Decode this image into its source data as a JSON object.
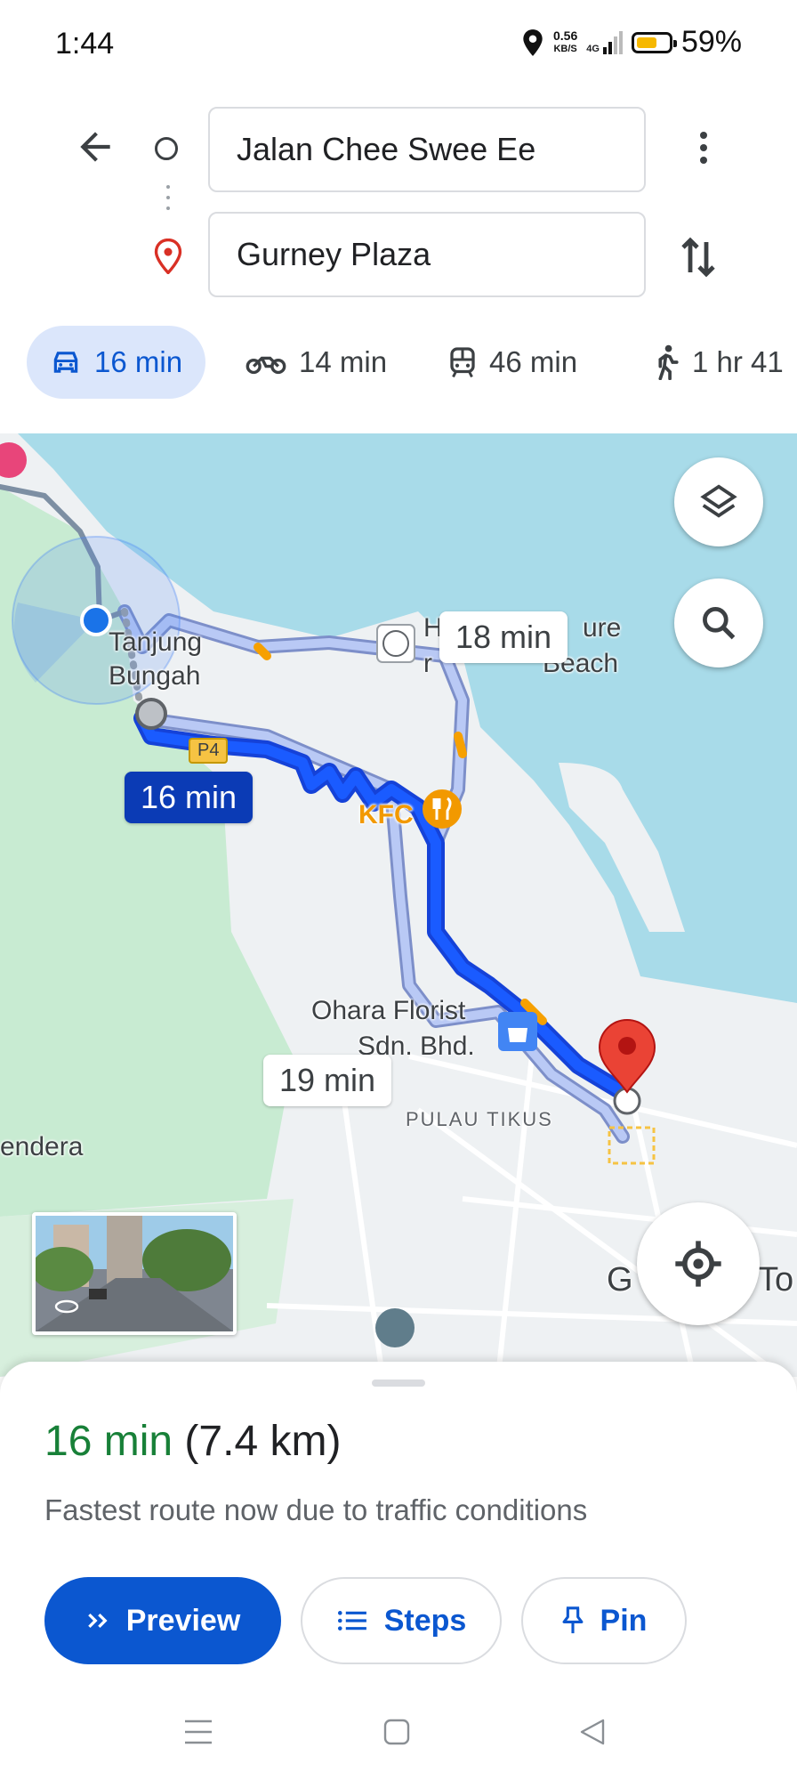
{
  "status_bar": {
    "time": "1:44",
    "net_speed_value": "0.56",
    "net_speed_unit": "KB/S",
    "network": "4G",
    "battery_percent": "59%"
  },
  "search": {
    "origin": "Jalan Chee Swee Ee",
    "destination": "Gurney Plaza"
  },
  "modes": [
    {
      "icon": "car-icon",
      "label": "16 min",
      "selected": true
    },
    {
      "icon": "motorcycle-icon",
      "label": "14 min"
    },
    {
      "icon": "transit-icon",
      "label": "46 min"
    },
    {
      "icon": "walk-icon",
      "label": "1 hr 41"
    }
  ],
  "map": {
    "route_chips": {
      "selected": "16 min",
      "alt1": "18 min",
      "alt2": "19 min"
    },
    "labels": {
      "tanjung": "Tanjung",
      "bungah": "Bungah",
      "road_p4": "P4",
      "kfc": "KFC",
      "beach_a": "H",
      "beach_b": "ure",
      "beach_c": "Beach",
      "beach_d": "r",
      "florist_1": "Ohara Florist",
      "florist_2": "Sdn. Bhd.",
      "pulau_tikus": "PULAU TIKUS",
      "bendera": "endera",
      "george_town_1": "G",
      "george_town_2": "To"
    },
    "colors": {
      "water": "#a8dbe9",
      "land": "#eef1f3",
      "park": "#c8ebd2",
      "route_selected": "#1a5bff",
      "route_alt": "#9fb7f5",
      "destination_pin": "#ea4335"
    }
  },
  "sheet": {
    "duration": "16 min",
    "distance": "(7.4 km)",
    "note": "Fastest route now due to traffic conditions",
    "buttons": {
      "preview": "Preview",
      "steps": "Steps",
      "pin": "Pin"
    }
  }
}
